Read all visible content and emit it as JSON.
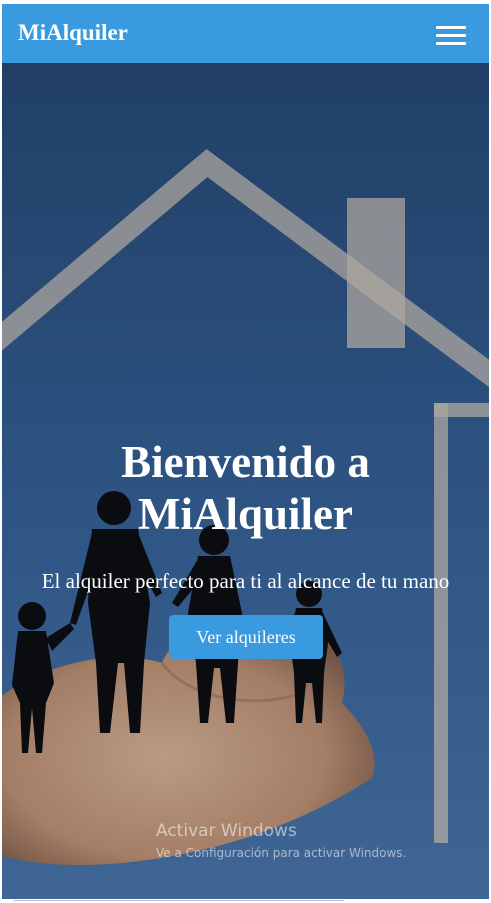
{
  "navbar": {
    "brand": "MiAlquiler",
    "menu_icon": "hamburger-menu-icon",
    "color": "#3a9ae0"
  },
  "hero": {
    "title_line1": "Bienvenido a",
    "title_line2": "MiAlquiler",
    "subtitle": "El alquiler perfecto para ti al alcance de tu mano",
    "cta_label": "Ver alquileres",
    "background_image": "family-silhouette-on-hand-under-house-outline"
  },
  "os_watermark": {
    "title": "Activar Windows",
    "subtitle": "Ve a Configuración para activar Windows."
  }
}
